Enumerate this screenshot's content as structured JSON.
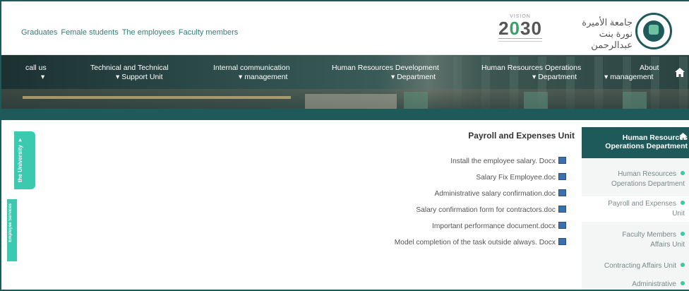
{
  "header": {
    "top_links": [
      "Graduates",
      "Female students",
      "The employees",
      "Faculty members"
    ],
    "vision_small": "VISION",
    "vision_year_a": "2",
    "vision_year_b": "0",
    "vision_year_c": "30",
    "university_name_line1": "جامعة الأميرة",
    "university_name_line2": "نورة بنت عبدالرحمن"
  },
  "nav": {
    "items": [
      {
        "l1": "call us",
        "l2": "▾"
      },
      {
        "l1": "Technical and Technical",
        "l2": "▾ Support Unit"
      },
      {
        "l1": "Internal communication",
        "l2": "▾ management"
      },
      {
        "l1": "Human Resources Development",
        "l2": "▾ Department"
      },
      {
        "l1": "Human Resources Operations",
        "l2": "▾ Department"
      },
      {
        "l1": "About",
        "l2": "▾ management"
      }
    ],
    "home_icon": "home-icon"
  },
  "side_tabs": {
    "university": "the University ▾",
    "employee": "Employee Services"
  },
  "main": {
    "title": "Payroll and Expenses Unit",
    "documents": [
      "Install the employee salary. Docx",
      "Salary Fix Employee.doc",
      "Administrative salary confirmation.doc",
      "Salary confirmation form for contractors.doc",
      "Important performance document.docx",
      "Model completion of the task outside always. Docx"
    ]
  },
  "sidebar": {
    "heading_line1": "Human Resources",
    "heading_line2": "Operations Department",
    "items": [
      {
        "line1": "Human Resources",
        "line2": "Operations Department"
      },
      {
        "line1": "Payroll and Expenses",
        "line2": "Unit"
      },
      {
        "line1": "Faculty Members",
        "line2": "Affairs Unit"
      },
      {
        "line1": "Contracting Affairs Unit",
        "line2": ""
      },
      {
        "line1": "Administrative",
        "line2": ""
      }
    ]
  },
  "colors": {
    "teal_dark": "#1f5a5a",
    "teal_accent": "#3bc9b0",
    "link": "#2f7f7a"
  }
}
